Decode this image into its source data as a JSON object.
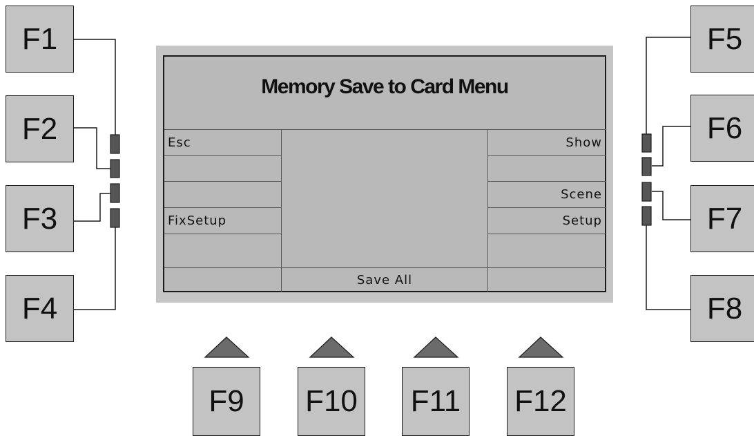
{
  "lcd": {
    "title": "Memory Save to Card Menu",
    "left_softkeys": [
      "Esc",
      "",
      "",
      "FixSetup",
      ""
    ],
    "right_softkeys": [
      "Show",
      "",
      "Scene",
      "Setup",
      ""
    ],
    "bottom_softkeys": [
      "",
      "Save All",
      ""
    ]
  },
  "function_keys": {
    "left": [
      "F1",
      "F2",
      "F3",
      "F4"
    ],
    "right": [
      "F5",
      "F6",
      "F7",
      "F8"
    ],
    "bottom": [
      "F9",
      "F10",
      "F11",
      "F12"
    ]
  },
  "colors": {
    "key_fill": "#c3c3c3",
    "screen_fill": "#b9b9b9",
    "bezel_fill": "#c5c5c5",
    "indicator_fill": "#555555",
    "arrow_fill": "#6b6b6b"
  }
}
